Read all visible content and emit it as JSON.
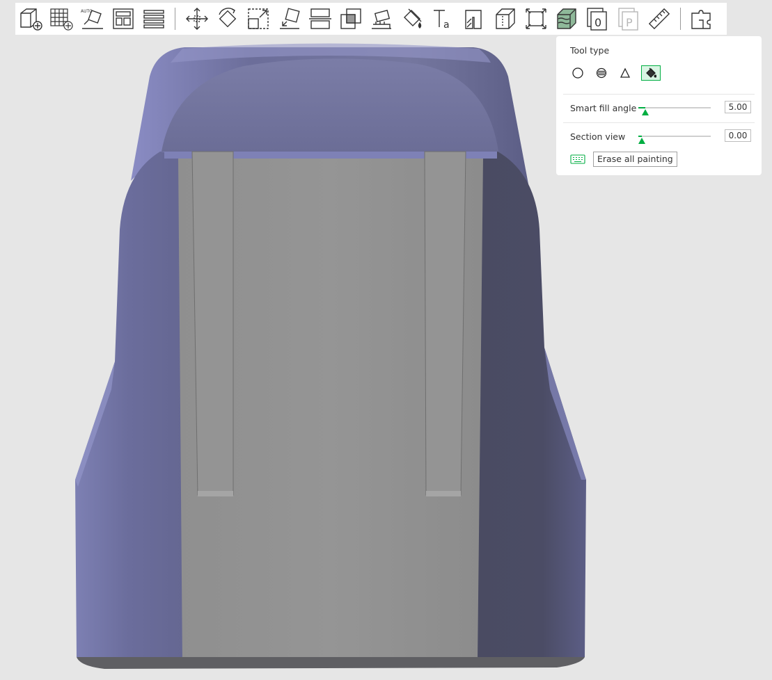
{
  "toolbar": {
    "items": [
      {
        "name": "add-icon"
      },
      {
        "name": "add-plate-icon"
      },
      {
        "name": "auto-orient-icon"
      },
      {
        "name": "arrange-icon"
      },
      {
        "name": "split-plates-icon"
      },
      {
        "name": "separator"
      },
      {
        "name": "move-icon"
      },
      {
        "name": "rotate-icon"
      },
      {
        "name": "scale-icon"
      },
      {
        "name": "lay-on-face-icon"
      },
      {
        "name": "cut-icon"
      },
      {
        "name": "boolean-icon"
      },
      {
        "name": "support-painting-icon"
      },
      {
        "name": "color-painting-icon"
      },
      {
        "name": "text-icon"
      },
      {
        "name": "seam-painting-icon"
      },
      {
        "name": "variable-layer-height-icon"
      },
      {
        "name": "measure-icon"
      },
      {
        "name": "fuzzy-skin-icon"
      },
      {
        "name": "object-list-icon"
      },
      {
        "name": "plate-icon"
      },
      {
        "name": "ruler-icon"
      },
      {
        "name": "separator"
      },
      {
        "name": "assembly-icon"
      }
    ]
  },
  "paint_panel": {
    "title": "Tool type",
    "tools": [
      {
        "name": "circle-tool-icon",
        "active": false
      },
      {
        "name": "sphere-tool-icon",
        "active": false
      },
      {
        "name": "triangle-tool-icon",
        "active": false
      },
      {
        "name": "fill-tool-icon",
        "active": true
      }
    ],
    "smart_fill_angle": {
      "label": "Smart fill angle",
      "value": "5.00",
      "fraction": 0.1
    },
    "section_view": {
      "label": "Section view",
      "value": "0.00",
      "fraction": 0.05
    },
    "erase_label": "Erase all painting",
    "accent_color": "#00ae42"
  }
}
